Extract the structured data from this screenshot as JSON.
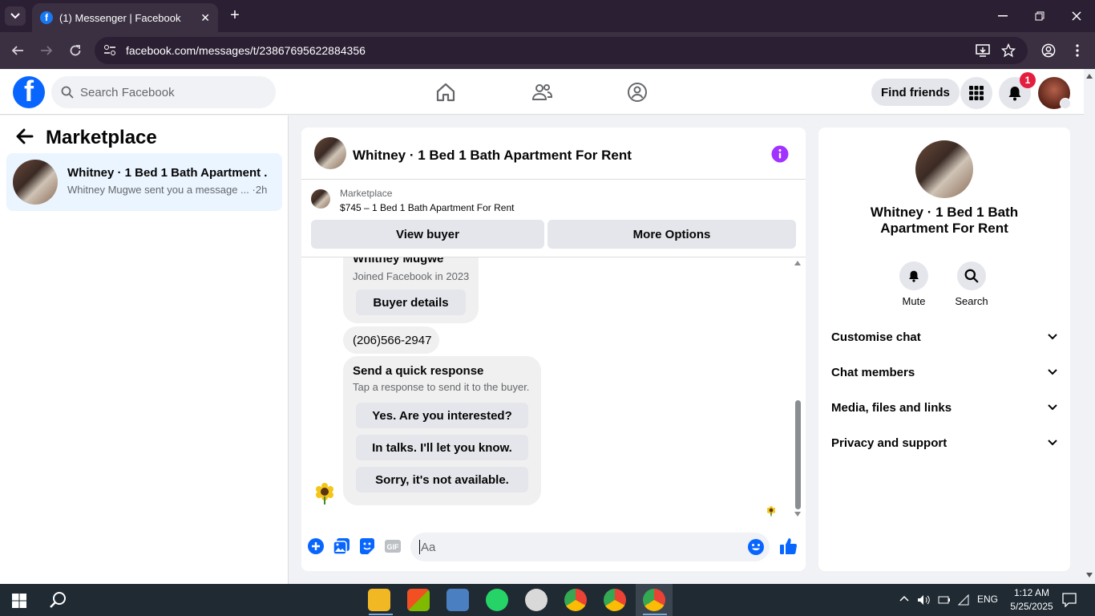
{
  "browser": {
    "tab_title": "(1) Messenger | Facebook",
    "url": "facebook.com/messages/t/23867695622884356"
  },
  "header": {
    "search_placeholder": "Search Facebook",
    "find_friends": "Find friends",
    "notification_count": "1"
  },
  "sidebar": {
    "title": "Marketplace",
    "conversation": {
      "name": "Whitney · 1 Bed 1 Bath Apartment ...",
      "preview": "Whitney Mugwe sent you a message ...",
      "time": "·2h"
    }
  },
  "chat": {
    "title": "Whitney · 1 Bed 1 Bath Apartment For Rent",
    "listing_source": "Marketplace",
    "listing_price": "$745 – 1 Bed 1 Bath Apartment For Rent",
    "view_buyer": "View buyer",
    "more_options": "More Options",
    "partial_name": "Whitney Mugwe",
    "joined": "Joined Facebook in 2023",
    "buyer_details": "Buyer details",
    "phone": "(206)566-2947",
    "quick_title": "Send a quick response",
    "quick_sub": "Tap a response to send it to the buyer.",
    "quick_responses": [
      "Yes. Are you interested?",
      "In talks. I'll let you know.",
      "Sorry, it's not available."
    ],
    "composer_placeholder": "Aa"
  },
  "info": {
    "name": "Whitney · 1 Bed 1 Bath Apartment For Rent",
    "mute": "Mute",
    "search": "Search",
    "sections": [
      "Customise chat",
      "Chat members",
      "Media, files and links",
      "Privacy and support"
    ]
  },
  "taskbar": {
    "lang": "ENG",
    "time": "1:12 AM",
    "date": "5/25/2025"
  },
  "colors": {
    "facebook_blue": "#0866ff",
    "messenger_accent": "#a033ff",
    "selected_conversation": "#ebf5ff"
  }
}
